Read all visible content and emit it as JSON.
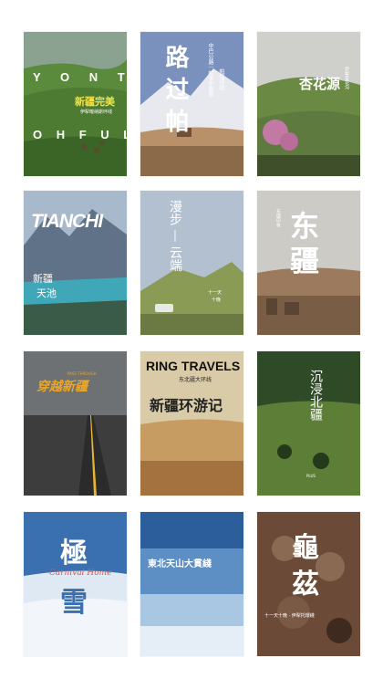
{
  "posters": [
    {
      "id": "p1",
      "big_letters_row1": "Y O N T",
      "big_letters_row2": "O H F U L .",
      "title_cn": "新疆完美",
      "subtitle_cn": "伊犁喀纳斯环线",
      "palette": {
        "sky": "#7f9a86",
        "grass": "#4e7b32",
        "dark": "#2c4a1f"
      }
    },
    {
      "id": "p2",
      "vertical_small": "中巴公路｜帕米尔高原",
      "vertical_small2": "帕塔环线",
      "big_calligraphy": "路 过 帕",
      "palette": {
        "sky": "#6f86b4",
        "snow": "#e7e9ee",
        "ground": "#8b6a4a"
      }
    },
    {
      "id": "p3",
      "title_cn": "杏花源",
      "side_text": "伊犁杏花沟",
      "palette": {
        "sky": "#d3d3d0",
        "hill": "#5f7a3e",
        "pink": "#c27aa4",
        "dark": "#3e4f2a"
      }
    },
    {
      "id": "p4",
      "title_en": "TIANCHI",
      "title_cn_line1": "新疆",
      "title_cn_line2": "天池",
      "palette": {
        "sky": "#9fb3c6",
        "mountain": "#5f7287",
        "lake": "#3fa7b7",
        "forest": "#3a5b48"
      }
    },
    {
      "id": "p5",
      "vertical_cn": "漫步 — 云端",
      "caption_line1": "十一天",
      "caption_line2": "十晚",
      "palette": {
        "sky": "#aebccd",
        "hill": "#8a9b55",
        "ground": "#6b7a43"
      }
    },
    {
      "id": "p6",
      "title_cn_top": "东",
      "title_cn_bottom": "疆",
      "side_small": "东疆印象",
      "palette": {
        "sky": "#c9c7c2",
        "rock": "#7a5d45",
        "town": "#5a4535"
      }
    },
    {
      "id": "p7",
      "title_cn": "穿越新疆",
      "title_en_small": "PASS THROUGH",
      "palette": {
        "sky": "#6d7174",
        "ground": "#3c3d3c",
        "road": "#2a2b2a",
        "line": "#e5b632"
      }
    },
    {
      "id": "p8",
      "title_en": "RING TRAVELS",
      "sub_cn": "东北疆大环线",
      "calligraphy": "新疆环游记",
      "palette": {
        "sky": "#d8c9a6",
        "sand": "#c79c63",
        "ground": "#a3723f"
      }
    },
    {
      "id": "p9",
      "title_cn": "沉浸北疆",
      "small_en": "PLUS",
      "palette": {
        "sky": "#2f4a27",
        "grass": "#5d7e37",
        "dark": "#233a1a"
      }
    },
    {
      "id": "p10",
      "title_cn": "極",
      "title_cn2": "雪",
      "script_en": "Carnival Home",
      "palette": {
        "sky": "#2c63a8",
        "snow": "#dfe9f3",
        "light": "#f2f6fa"
      }
    },
    {
      "id": "p11",
      "title_cn": "東北天山大貫綫",
      "palette": {
        "sky": "#2b5e9b",
        "mid": "#a9c6e2",
        "snow": "#e5eef6"
      }
    },
    {
      "id": "p12",
      "title_cn_top": "龜",
      "title_cn_bottom": "茲",
      "caption": "十一天十晚 · 伊犁托環綫",
      "palette": {
        "bg": "#6b4a37",
        "stone": "#8a6a52",
        "dark": "#3f2a1f"
      }
    }
  ],
  "icons": {
    "brand_logo": "mountain-logo-icon"
  }
}
